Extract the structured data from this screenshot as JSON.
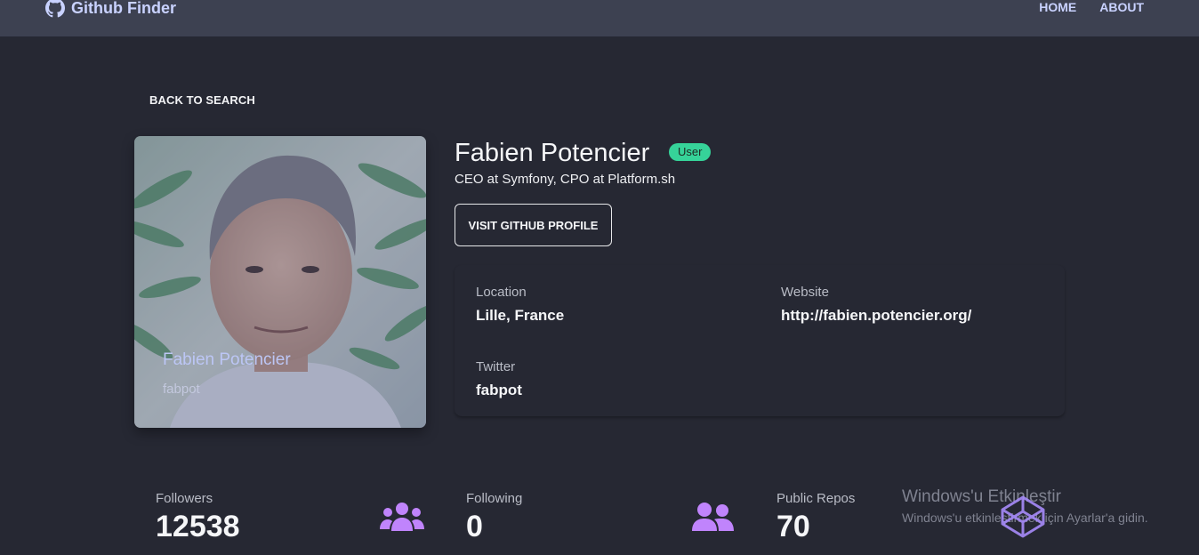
{
  "navbar": {
    "brand": "Github Finder",
    "links": [
      "HOME",
      "ABOUT"
    ]
  },
  "back_link": "BACK TO SEARCH",
  "avatar": {
    "name": "Fabien Potencier",
    "login": "fabpot"
  },
  "profile": {
    "name": "Fabien Potencier",
    "badge": "User",
    "bio": "CEO at Symfony, CPO at Platform.sh",
    "visit_button": "VISIT GITHUB PROFILE"
  },
  "info": {
    "location_label": "Location",
    "location_value": "Lille, France",
    "website_label": "Website",
    "website_value": "http://fabien.potencier.org/",
    "twitter_label": "Twitter",
    "twitter_value": "fabpot"
  },
  "stats": {
    "followers_label": "Followers",
    "followers_value": "12538",
    "following_label": "Following",
    "following_value": "0",
    "repos_label": "Public Repos",
    "repos_value": "70"
  },
  "watermark": {
    "title": "Windows'u Etkinleştir",
    "subtitle": "Windows'u etkinleştirmek için Ayarlar'a gidin."
  },
  "colors": {
    "background": "#262833",
    "navbar": "#3d4151",
    "accent": "#c9d2ff",
    "badge": "#36d399",
    "stat_icon": "#c084fc"
  },
  "icons": {
    "brand": "github-icon",
    "followers": "users-icon",
    "following": "users-icon",
    "watermark": "codepen-icon"
  }
}
